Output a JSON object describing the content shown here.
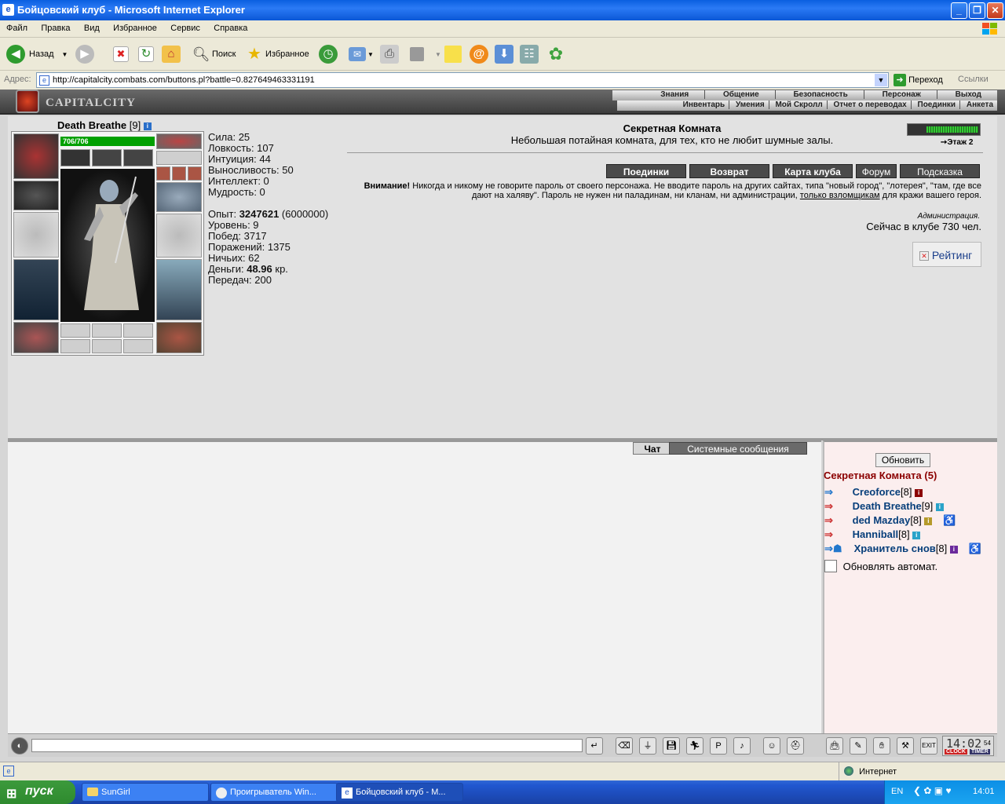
{
  "window": {
    "title": "Бойцовский клуб - Microsoft Internet Explorer"
  },
  "menu": [
    "Файл",
    "Правка",
    "Вид",
    "Избранное",
    "Сервис",
    "Справка"
  ],
  "toolbar": {
    "back": "Назад",
    "search": "Поиск",
    "favorites": "Избранное"
  },
  "address": {
    "label": "Адрес:",
    "url": "http://capitalcity.combats.com/buttons.pl?battle=0.827649463331191",
    "go": "Переход",
    "links": "Ссылки"
  },
  "site": {
    "logo": "CAPITALCITY",
    "nav_top": [
      "Знания",
      "Общение",
      "Безопасность",
      "Персонаж",
      "Выход"
    ],
    "nav_bottom": [
      "Инвентарь",
      "Умения",
      "Мой Скролл",
      "Отчет о переводах",
      "Поединки",
      "Анкета"
    ]
  },
  "character": {
    "name": "Death Breathe",
    "level": "[9]",
    "hp": "706/706",
    "stats": [
      "Сила: 25",
      "Ловкость: 107",
      "Интуиция: 44",
      "Выносливость: 50",
      "Интеллект: 0",
      "Мудрость: 0"
    ],
    "exp_label": "Опыт: ",
    "exp_value": "3247621",
    "exp_next": " (6000000)",
    "level_line": "Уровень: 9",
    "wins": "Побед: 3717",
    "losses": "Поражений: 1375",
    "draws": "Ничьих: 62",
    "money_label": "Деньги: ",
    "money_value": "48.96",
    "money_unit": " кр.",
    "transfers": "Передач: 200"
  },
  "room": {
    "name": "Секретная Комната",
    "description": "Небольшая потайная комната, для тех, кто не любит шумные залы.",
    "floor": "Этаж 2",
    "buttons": [
      "Поединки",
      "Возврат",
      "Карта клуба",
      "Форум",
      "Подсказка"
    ],
    "warning_bold": "Внимание!",
    "warning_text": " Никогда и никому не говорите пароль от своего персонажа. Не вводите пароль на других сайтах, типа \"новый город\", \"лотерея\", \"там, где все дают на халяву\". Пароль не нужен ни паладинам, ни кланам, ни администрации, ",
    "warning_link": "только взломщикам",
    "warning_end": " для кражи вашего героя.",
    "admin": "Администрация.",
    "online": "Сейчас в клубе 730 чел.",
    "rating": "Рейтинг"
  },
  "chat": {
    "tab_chat": "Чат",
    "tab_system": "Системные сообщения"
  },
  "userlist": {
    "refresh": "Обновить",
    "room_title": "Секретная Комната (5)",
    "users": [
      {
        "name": "Creoforce",
        "level": "[8]",
        "color": "#8b0000"
      },
      {
        "name": "Death Breathe",
        "level": "[9]",
        "color": "#2aa3c9"
      },
      {
        "name": "ded Mazday",
        "level": "[8]",
        "color": "#b59a2a"
      },
      {
        "name": "Hanniball",
        "level": "[8]",
        "color": "#2aa3c9"
      },
      {
        "name": "Хранитель снов",
        "level": "[8]",
        "color": "#6b2a9c"
      }
    ],
    "auto_refresh": "Обновлять автомат."
  },
  "clock": {
    "time": "14:02",
    "seconds": "54",
    "label1": "CLOCK",
    "label2": "TIMER"
  },
  "status": {
    "zone": "Интернет"
  },
  "taskbar": {
    "start": "пуск",
    "tasks": [
      "SunGirl",
      "Проигрыватель Win...",
      "Бойцовский клуб - М..."
    ],
    "lang": "EN",
    "time": "14:01"
  }
}
